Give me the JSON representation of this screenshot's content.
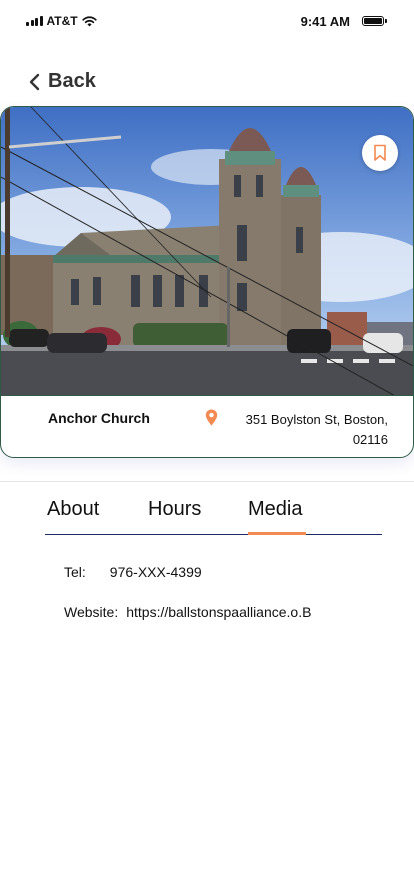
{
  "status_bar": {
    "carrier": "AT&T",
    "time": "9:41 AM"
  },
  "nav": {
    "back_label": "Back"
  },
  "place": {
    "name": "Anchor Church",
    "address": "351 Boylston St, Boston, 02116"
  },
  "tabs": [
    {
      "label": "About"
    },
    {
      "label": "Hours"
    },
    {
      "label": "Media",
      "active": true
    }
  ],
  "details": {
    "tel_label": "Tel:",
    "tel_value": "976-XXX-4399",
    "website_label": "Website:",
    "website_value": "https://ballstonspaalliance.o.B"
  },
  "colors": {
    "accent": "#f28a52",
    "card_border": "#2f5a45",
    "tab_rule": "#1c2a66"
  },
  "icons": {
    "bookmark": "bookmark-icon",
    "location": "location-pin-icon",
    "back": "chevron-left-icon"
  }
}
